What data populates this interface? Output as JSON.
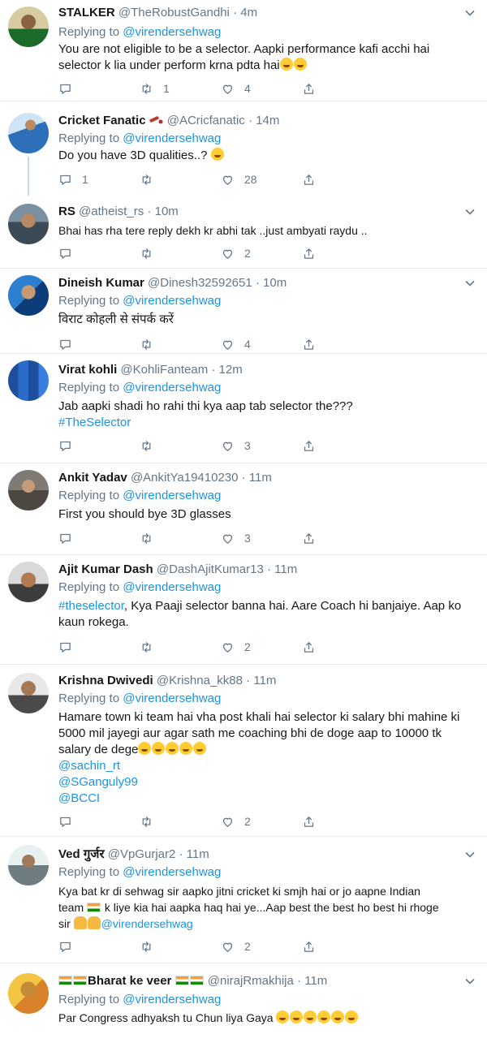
{
  "reply_prefix": "Replying to",
  "tweets": [
    {
      "name": "STALKER",
      "handle": "@TheRobustGandhi",
      "time": "4m",
      "replying_to": "@virendersehwag",
      "lines": [
        "You are not eligible to be a selector. Aapki performance kafi acchi hai",
        "selector k lia under perform krna pdta hai"
      ],
      "replies": "",
      "retweets": "1",
      "likes": "4"
    },
    {
      "name": "Cricket Fanatic",
      "handle": "@ACricfanatic",
      "time": "14m",
      "replying_to": "@virendersehwag",
      "lines": [
        "Do you have 3D qualities..?"
      ],
      "replies": "1",
      "retweets": "",
      "likes": "28"
    },
    {
      "name": "RS",
      "handle": "@atheist_rs",
      "time": "10m",
      "replying_to": "",
      "lines": [
        "Bhai has rha tere reply dekh kr abhi tak ..just ambyati raydu .."
      ],
      "replies": "",
      "retweets": "",
      "likes": "2"
    },
    {
      "name": "Dineish Kumar",
      "handle": "@Dinesh32592651",
      "time": "10m",
      "replying_to": "@virendersehwag",
      "lines": [
        "विराट कोहली से संपर्क करें"
      ],
      "replies": "",
      "retweets": "",
      "likes": "4"
    },
    {
      "name": "Virat kohli",
      "handle": "@KohliFanteam",
      "time": "12m",
      "replying_to": "@virendersehwag",
      "lines": [
        "Jab aapki shadi ho rahi thi kya aap tab selector the???"
      ],
      "hashtags": [
        "#TheSelector"
      ],
      "replies": "",
      "retweets": "",
      "likes": "3"
    },
    {
      "name": "Ankit Yadav",
      "handle": "@AnkitYa19410230",
      "time": "11m",
      "replying_to": "@virendersehwag",
      "lines": [
        "First you should bye 3D glasses"
      ],
      "replies": "",
      "retweets": "",
      "likes": "3"
    },
    {
      "name": "Ajit Kumar Dash",
      "handle": "@DashAjitKumar13",
      "time": "11m",
      "replying_to": "@virendersehwag",
      "hashtag_inline": "#theselector",
      "lines": [
        ", Kya Paaji selector banna hai. Aare Coach hi banjaiye. Aap ko",
        "kaun rokega."
      ],
      "replies": "",
      "retweets": "",
      "likes": "2"
    },
    {
      "name": "Krishna Dwivedi",
      "handle": "@Krishna_kk88",
      "time": "11m",
      "replying_to": "@virendersehwag",
      "lines": [
        "Hamare town ki team hai vha post khali hai selector ki salary bhi mahine ki",
        "5000 mil jayegi aur agar sath me coaching bhi de doge aap to 10000 tk",
        "salary de dege"
      ],
      "mentions": [
        "@sachin_rt",
        "@SGanguly99",
        "@BCCI"
      ],
      "replies": "",
      "retweets": "",
      "likes": "2"
    },
    {
      "name": "Ved गुर्जर",
      "handle": "@VpGurjar2",
      "time": "11m",
      "replying_to": "@virendersehwag",
      "lines": [
        "Kya bat kr di sehwag sir  aapko jitni cricket ki smjh hai or jo aapne Indian",
        "k liye kia hai aapka haq hai ye...Aap best the best ho best hi rhoge"
      ],
      "line2_prefix": "team",
      "line3_prefix": "sir",
      "line3_mention": "@virendersehwag",
      "replies": "",
      "retweets": "",
      "likes": "2"
    },
    {
      "name": "Bharat ke veer",
      "handle": "@nirajRmakhija",
      "time": "11m",
      "replying_to": "@virendersehwag",
      "lines": [
        "Par Congress adhyaksh tu Chun liya Gaya"
      ],
      "replies": "",
      "retweets": "",
      "likes": ""
    }
  ],
  "icons": [
    "reply-icon",
    "retweet-icon",
    "like-icon",
    "share-icon",
    "caret-down-icon"
  ],
  "colors": {
    "link": "#1b95e0",
    "muted": "#657786",
    "divider": "#e6ecf0",
    "text": "#14171a"
  }
}
